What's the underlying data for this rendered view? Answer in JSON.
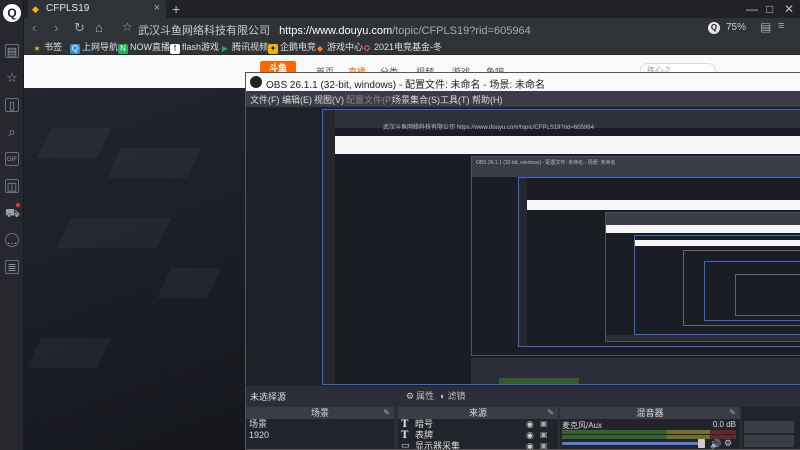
{
  "browser": {
    "tab_title": "CFPLS19",
    "tab_close": "×",
    "new_tab": "+",
    "url_label": "武汉斗鱼网络科技有限公司",
    "url_domain": "https://www.douyu.com",
    "url_path": "/topic/CFPLS19?rid=605964",
    "zoom": "75%",
    "zoom_icon_text": "Q",
    "window_controls": [
      "—",
      "□",
      "✕"
    ]
  },
  "bookmarks": [
    {
      "label": "书签",
      "color": "#f5a623",
      "glyph": "★"
    },
    {
      "label": "上网导航",
      "color": "#3a8ee6",
      "glyph": "Q"
    },
    {
      "label": "NOW直播",
      "color": "#19b35a",
      "glyph": "N"
    },
    {
      "label": "flash游戏",
      "color": "#ffffff",
      "glyph": "f"
    },
    {
      "label": "腾讯视频",
      "color": "#28a745",
      "glyph": "▶"
    },
    {
      "label": "企鹅电竞",
      "color": "#f0b400",
      "glyph": "✦"
    },
    {
      "label": "游戏中心",
      "color": "#ff7a1a",
      "glyph": "◆"
    },
    {
      "label": "2021电竞基金-冬",
      "color": "#e94c4c",
      "glyph": "✪"
    }
  ],
  "douyu": {
    "nav": [
      "首页",
      "直播",
      "分类",
      "视频",
      "游戏",
      "鱼吧"
    ],
    "active_nav": "直播",
    "search_placeholder": "练心-2",
    "logo_text": "斗鱼"
  },
  "obs": {
    "title": "OBS 26.1.1 (32-bit, windows) - 配置文件: 未命名 - 场景: 未命名",
    "menu": [
      "文件(F)",
      "编辑(E)",
      "视图(V)",
      "配置文件(P)",
      "场景集合(S)",
      "工具(T)",
      "帮助(H)"
    ],
    "disabled_menu": "配置文件(P)",
    "no_source": "未选择源",
    "properties_btn": "属性",
    "filters_btn": "滤镜",
    "dock_scenes": "场景",
    "dock_sources": "来源",
    "dock_mixer": "混音器",
    "scenes": [
      "场景",
      "1920"
    ],
    "sources": [
      {
        "icon": "T",
        "name": "暗号"
      },
      {
        "icon": "T",
        "name": "表牌"
      },
      {
        "icon": "▭",
        "name": "显示器采集"
      }
    ],
    "mixer": {
      "name": "麦克风/Aux",
      "db": "0.0 dB"
    }
  },
  "nested": {
    "title": "OBS 26.1.1 (32-bit, windows) - 配置文件: 未命名 - 场景: 未命名",
    "url": "武汉斗鱼网络科技有限公司  https://www.douyu.com/topic/CFPLS19?rid=605964"
  }
}
